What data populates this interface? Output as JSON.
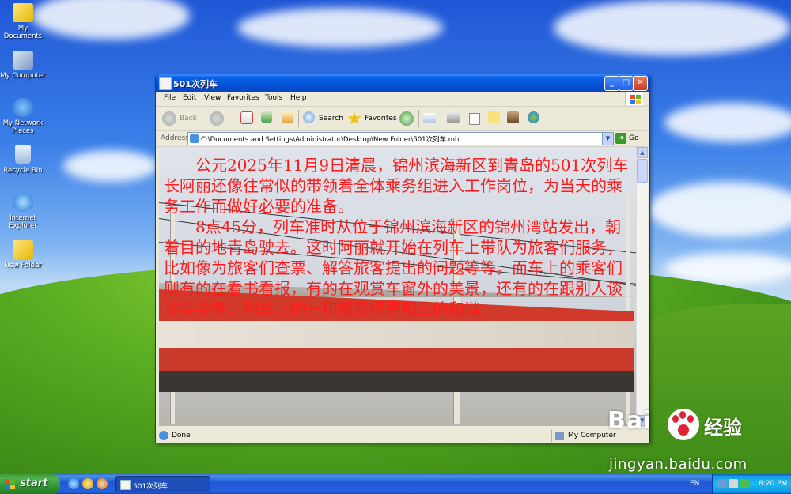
{
  "desktop": {
    "icons": [
      {
        "label": "My Documents"
      },
      {
        "label": "My Computer"
      },
      {
        "label": "My Network Places"
      },
      {
        "label": "Recycle Bin"
      },
      {
        "label": "Internet Explorer"
      },
      {
        "label": "New Folder"
      }
    ]
  },
  "window": {
    "title": "501次列车",
    "buttons": {
      "minimize": "_",
      "maximize": "□",
      "close": "✕"
    },
    "menu": [
      "File",
      "Edit",
      "View",
      "Favorites",
      "Tools",
      "Help"
    ],
    "toolbar": {
      "back": "Back",
      "search": "Search",
      "favorites": "Favorites"
    },
    "address": {
      "label": "Address",
      "value": "C:\\Documents and Settings\\Administrator\\Desktop\\New Folder\\501次列车.mht",
      "go": "Go"
    },
    "content": {
      "paragraphs": [
        "公元2025年11月9日清晨，锦州滨海新区到青岛的501次列车长阿丽还像往常似的带领着全体乘务组进入工作岗位，为当天的乘务工作而做好必要的准备。",
        "8点45分，列车准时从位于锦州滨海新区的锦州湾站发出，朝着目的地青岛驶去。这时阿丽就开始在列车上带队为旅客们服务，比如像为旅客们查票、解答旅客提出的问题等等。而车上的乘客们则有的在看书看报，有的在观赏车窗外的美景，还有的在跟别人谈谈笑笑等。列车上的一切都显得是那么的和谐"
      ]
    },
    "status": {
      "text": "Done",
      "zone": "My Computer"
    }
  },
  "taskbar": {
    "start": "start",
    "task": "501次列车",
    "language": "EN",
    "clock": "8:20 PM"
  },
  "watermark": {
    "brand": "Bai",
    "brand_cn": "经验",
    "url": "jingyan.baidu.com"
  }
}
